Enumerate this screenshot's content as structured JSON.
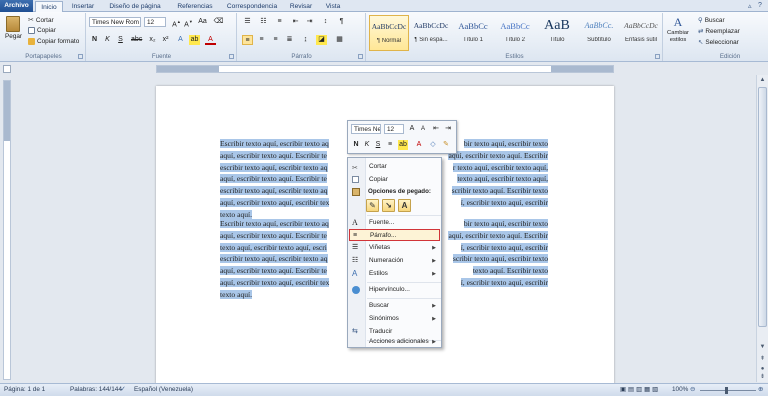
{
  "tabs": {
    "file": "Archivo",
    "items": [
      "Inicio",
      "Insertar",
      "Diseño de página",
      "Referencias",
      "Correspondencia",
      "Revisar",
      "Vista"
    ]
  },
  "ribbon": {
    "clipboard": {
      "paste": "Pegar",
      "cut": "Cortar",
      "copy": "Copiar",
      "format_painter": "Copiar formato",
      "label": "Portapapeles"
    },
    "font": {
      "font_name": "Times New Rom",
      "font_size": "12",
      "label": "Fuente"
    },
    "paragraph": {
      "label": "Párrafo"
    },
    "styles": {
      "label": "Estilos",
      "items": [
        {
          "sample": "AaBbCcDc",
          "name": "¶ Normal"
        },
        {
          "sample": "AaBbCcDc",
          "name": "¶ Sin espa..."
        },
        {
          "sample": "AaBbCc",
          "name": "Título 1"
        },
        {
          "sample": "AaBbCc",
          "name": "Título 2"
        },
        {
          "sample": "AaB",
          "name": "Título"
        },
        {
          "sample": "AaBbCc.",
          "name": "Subtítulo"
        },
        {
          "sample": "AaBbCcDc",
          "name": "Énfasis sutil"
        }
      ],
      "change_styles": "Cambiar estilos"
    },
    "editing": {
      "find": "Buscar",
      "replace": "Reemplazar",
      "select": "Seleccionar",
      "label": "Edición"
    }
  },
  "document": {
    "paragraph1_lines": [
      "Escribir texto aquí, escribir texto aq",
      "aquí, escribir texto aquí. Escribir te",
      "escribir texto aquí, escribir texto aq",
      "aquí, escribir texto aquí. Escribir te",
      "escribir texto aquí, escribir texto aq",
      "aquí, escribir texto aquí, escribir tex",
      "texto aquí."
    ],
    "paragraph1_right": [
      "bir texto aquí, escribir texto",
      "aquí, escribir texto aquí. Escribir",
      "r texto aquí, escribir texto aquí,",
      "texto aquí, escribir texto aquí,",
      "scribir texto aquí. Escribir texto",
      "í, escribir texto aquí, escribir"
    ],
    "paragraph2_lines": [
      "Escribir texto aquí, escribir texto aq",
      "aquí, escribir texto aquí. Escribir te",
      "texto aquí, escribir texto aquí, escri",
      "escribir texto aquí, escribir texto aq",
      "aquí, escribir texto aquí. Escribir te",
      "aquí, escribir texto aquí, escribir tex",
      "texto aquí."
    ],
    "paragraph2_right": [
      "bir texto aquí, escribir texto",
      "aquí, escribir texto aquí. Escribir",
      "í, escribir texto aquí, escribir",
      "scribir texto aquí, escribir texto",
      "texto aquí. Escribir texto",
      "í, escribir texto aquí, escribir"
    ]
  },
  "mini_toolbar": {
    "font_name": "Times Ne",
    "font_size": "12"
  },
  "context_menu": {
    "cut": "Cortar",
    "copy": "Copiar",
    "paste_options": "Opciones de pegado:",
    "font": "Fuente...",
    "paragraph": "Párrafo...",
    "bullets": "Viñetas",
    "numbering": "Numeración",
    "styles": "Estilos",
    "hyperlink": "Hipervínculo...",
    "search": "Buscar",
    "synonyms": "Sinónimos",
    "translate": "Traducir",
    "additional_actions": "Acciones adicionales"
  },
  "status_bar": {
    "page": "Página: 1 de 1",
    "words": "Palabras: 144/144",
    "language": "Español (Venezuela)",
    "zoom": "100%"
  },
  "colors": {
    "selection": "#a9c6e8",
    "file_tab": "#2a5ea3",
    "highlight_border": "#d13438"
  }
}
